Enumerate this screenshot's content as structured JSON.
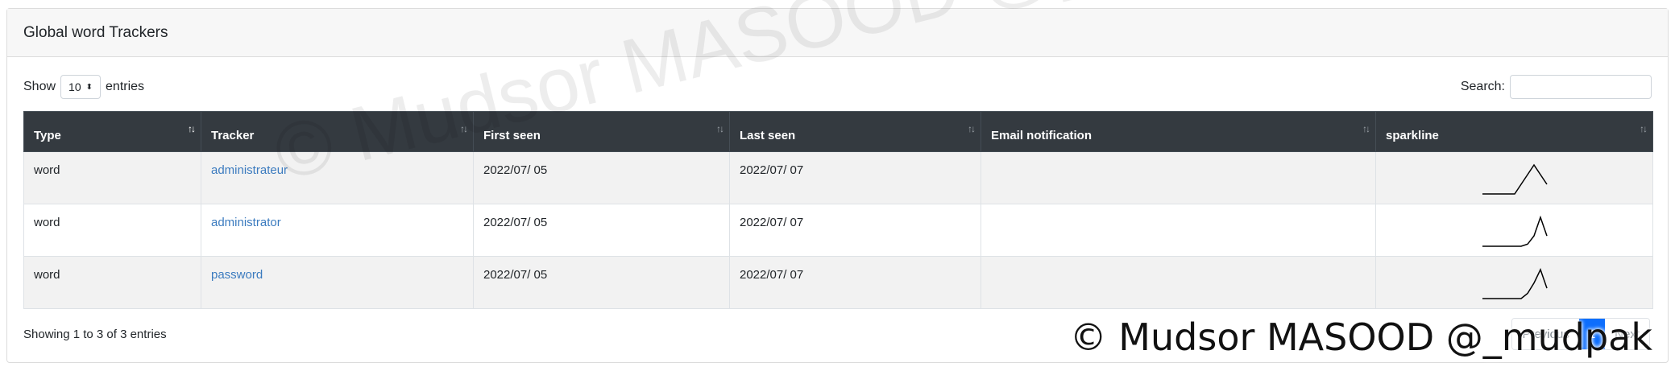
{
  "card": {
    "title": "Global word Trackers"
  },
  "controls": {
    "show_label": "Show",
    "entries_value": "10",
    "entries_label": "entries",
    "search_label": "Search:",
    "search_value": ""
  },
  "table": {
    "headers": [
      "Type",
      "Tracker",
      "First seen",
      "Last seen",
      "Email notification",
      "sparkline"
    ],
    "rows": [
      {
        "type": "word",
        "tracker": "administrateur",
        "first_seen": "2022/07/ 05",
        "last_seen": "2022/07/ 07",
        "email": "",
        "sparkline": [
          0,
          0,
          0,
          0,
          0,
          0,
          1,
          2,
          3,
          2,
          1
        ]
      },
      {
        "type": "word",
        "tracker": "administrator",
        "first_seen": "2022/07/ 05",
        "last_seen": "2022/07/ 07",
        "email": "",
        "sparkline": [
          0,
          0,
          0,
          0,
          0,
          0,
          0,
          0.2,
          1,
          2.8,
          1
        ]
      },
      {
        "type": "word",
        "tracker": "password",
        "first_seen": "2022/07/ 05",
        "last_seen": "2022/07/ 07",
        "email": "",
        "sparkline": [
          0,
          0,
          0,
          0,
          0,
          0,
          0,
          0.5,
          1.5,
          2.8,
          1
        ]
      }
    ]
  },
  "footer": {
    "info": "Showing 1 to 3 of 3 entries",
    "prev": "Previous",
    "page": "1",
    "next": "Next"
  },
  "watermark": {
    "text": "© Mudsor MASOOD @_mudpak"
  }
}
